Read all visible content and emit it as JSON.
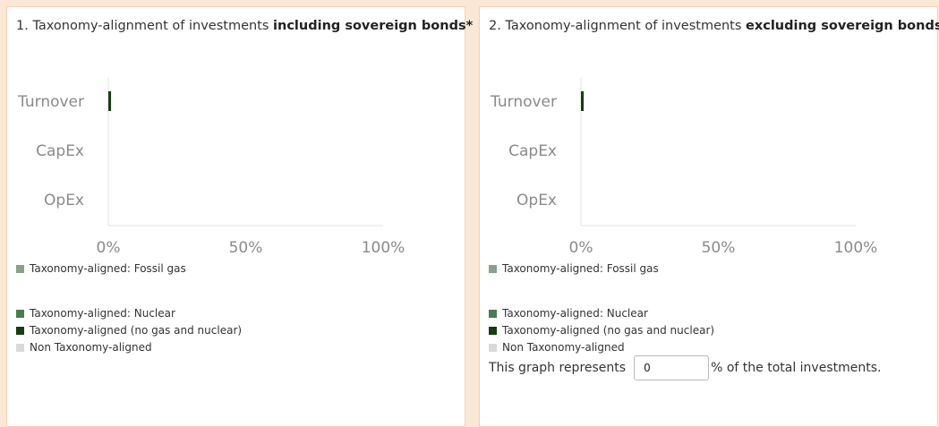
{
  "panels": [
    {
      "title_prefix": "1. Taxonomy-alignment of investments ",
      "title_bold": "including sovereign bonds*"
    },
    {
      "title_prefix": "2. Taxonomy-alignment of investments ",
      "title_bold": "excluding sovereign bonds*"
    }
  ],
  "legend": {
    "fossil_gas": "Taxonomy-aligned: Fossil gas",
    "nuclear": "Taxonomy-aligned: Nuclear",
    "no_gas_nuclear": "Taxonomy-aligned (no gas and nuclear)",
    "non_aligned": "Non Taxonomy-aligned"
  },
  "colors": {
    "fossil_gas": "#86a38a",
    "nuclear": "#4d7a50",
    "no_gas_nuclear": "#173d12",
    "non_aligned": "#d9d9d9"
  },
  "footer": {
    "prefix": "This graph represents",
    "value": "0",
    "suffix": "% of the total investments."
  },
  "chart_data": [
    {
      "type": "bar",
      "orientation": "horizontal",
      "stacked": true,
      "categories": [
        "Turnover",
        "CapEx",
        "OpEx"
      ],
      "series": [
        {
          "name": "Taxonomy-aligned: Fossil gas",
          "values": [
            0,
            0,
            0
          ]
        },
        {
          "name": "Taxonomy-aligned: Nuclear",
          "values": [
            0,
            0,
            0
          ]
        },
        {
          "name": "Taxonomy-aligned (no gas and nuclear)",
          "values": [
            1,
            0,
            0
          ]
        },
        {
          "name": "Non Taxonomy-aligned",
          "values": [
            0,
            0,
            0
          ]
        }
      ],
      "x_ticks": [
        "0%",
        "50%",
        "100%"
      ],
      "xlim": [
        0,
        100
      ],
      "grid": false
    },
    {
      "type": "bar",
      "orientation": "horizontal",
      "stacked": true,
      "categories": [
        "Turnover",
        "CapEx",
        "OpEx"
      ],
      "series": [
        {
          "name": "Taxonomy-aligned: Fossil gas",
          "values": [
            0,
            0,
            0
          ]
        },
        {
          "name": "Taxonomy-aligned: Nuclear",
          "values": [
            0,
            0,
            0
          ]
        },
        {
          "name": "Taxonomy-aligned (no gas and nuclear)",
          "values": [
            1,
            0,
            0
          ]
        },
        {
          "name": "Non Taxonomy-aligned",
          "values": [
            0,
            0,
            0
          ]
        }
      ],
      "x_ticks": [
        "0%",
        "50%",
        "100%"
      ],
      "xlim": [
        0,
        100
      ],
      "grid": false
    }
  ]
}
